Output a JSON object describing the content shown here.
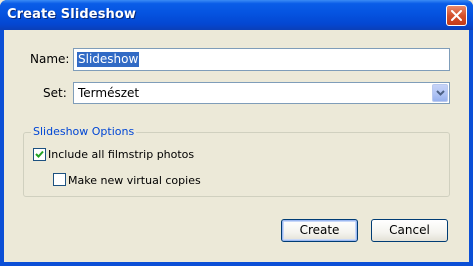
{
  "window": {
    "title": "Create Slideshow"
  },
  "icons": {
    "close": "close-x-icon",
    "dropdown": "chevron-down-icon",
    "check": "checkmark-icon"
  },
  "form": {
    "name_label": "Name:",
    "name_value": "Slideshow",
    "set_label": "Set:",
    "set_value": "Természet"
  },
  "options": {
    "group_title": "Slideshow Options",
    "include_all": {
      "label": "Include all filmstrip photos",
      "checked": true
    },
    "virtual_copies": {
      "label": "Make new virtual copies",
      "checked": false
    }
  },
  "buttons": {
    "create": "Create",
    "cancel": "Cancel"
  },
  "colors": {
    "titlebar": "#0553e0",
    "selection": "#316ac5",
    "group_title": "#0046d5",
    "dialog_bg": "#ece9d8"
  }
}
